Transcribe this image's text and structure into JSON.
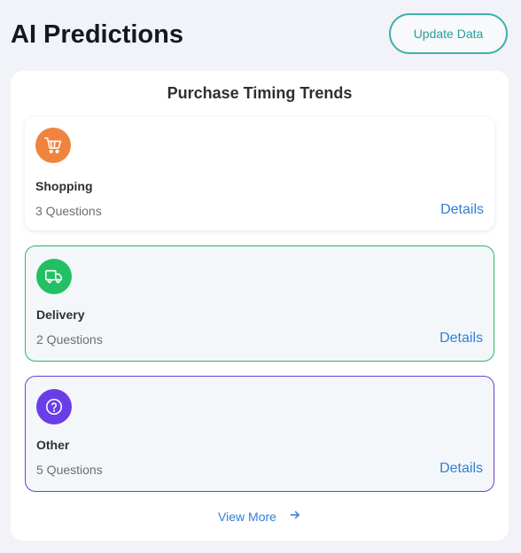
{
  "header": {
    "title": "AI Predictions",
    "update_label": "Update Data"
  },
  "panel": {
    "title": "Purchase Timing Trends",
    "cards": [
      {
        "name": "Shopping",
        "count": "3 Questions",
        "details_label": "Details",
        "icon": "shopping-cart-icon",
        "icon_color": "#f0843f"
      },
      {
        "name": "Delivery",
        "count": "2 Questions",
        "details_label": "Details",
        "icon": "delivery-truck-icon",
        "icon_color": "#22c063",
        "border_color": "#27b95f"
      },
      {
        "name": "Other",
        "count": "5 Questions",
        "details_label": "Details",
        "icon": "question-icon",
        "icon_color": "#6a3ee6",
        "border_color": "#6a42d4"
      }
    ],
    "view_more_label": "View More"
  },
  "colors": {
    "accent_teal": "#3fb1ae",
    "link_blue": "#2f7fd6",
    "background": "#f2f3f8"
  }
}
